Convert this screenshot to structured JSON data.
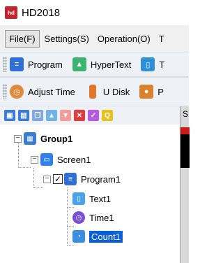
{
  "app": {
    "title": "HD2018",
    "icon_text": "hd"
  },
  "menu": [
    {
      "label": "File(F)",
      "active": true
    },
    {
      "label": "Settings(S)",
      "active": false
    },
    {
      "label": "Operation(O)",
      "active": false
    },
    {
      "label": "T",
      "active": false
    }
  ],
  "toolbar1": [
    {
      "label": "Program",
      "icon": "program-icon",
      "color": "#2f6fd6"
    },
    {
      "label": "HyperText",
      "icon": "image-icon",
      "color": "#3cb371"
    },
    {
      "label": "T",
      "icon": "text-icon",
      "color": "#2f8fd6"
    }
  ],
  "toolbar2": [
    {
      "label": "Adjust Time",
      "icon": "clock-icon",
      "color": "#e08a3c"
    },
    {
      "label": "U Disk",
      "icon": "usb-icon",
      "color": "#e0782a"
    },
    {
      "label": "P",
      "icon": "people-icon",
      "color": "#d9822b"
    }
  ],
  "tree_toolbar": [
    {
      "icon": "add-screen-icon",
      "color": "#3a7bd5",
      "glyph": "▣"
    },
    {
      "icon": "add-program-icon",
      "color": "#3a7bd5",
      "glyph": "▤"
    },
    {
      "icon": "copy-icon",
      "color": "#7fa8e0",
      "glyph": "❐"
    },
    {
      "icon": "move-up-icon",
      "color": "#6fb3e8",
      "glyph": "▲"
    },
    {
      "icon": "move-down-icon",
      "color": "#f29c9c",
      "glyph": "▼"
    },
    {
      "icon": "delete-icon",
      "color": "#e23b3b",
      "glyph": "✕"
    },
    {
      "icon": "check-icon",
      "color": "#b65be0",
      "glyph": "✓"
    },
    {
      "icon": "search-icon",
      "color": "#e8c21a",
      "glyph": "Q"
    }
  ],
  "tree": {
    "group": {
      "label": "Group1"
    },
    "screen": {
      "label": "Screen1"
    },
    "program": {
      "label": "Program1",
      "checked": true,
      "check_glyph": "✓"
    },
    "children": [
      {
        "label": "Text1",
        "icon": "text-area-icon"
      },
      {
        "label": "Time1",
        "icon": "time-icon"
      },
      {
        "label": "Count1",
        "icon": "count-icon",
        "selected": true
      }
    ]
  },
  "right_panel": {
    "text": "S"
  }
}
